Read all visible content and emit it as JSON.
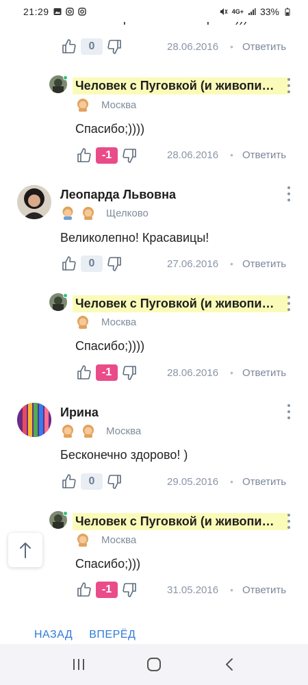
{
  "status_bar": {
    "time": "21:29",
    "network": "4G+",
    "battery": "33%"
  },
  "partial_comment": {
    "text": "Классно! Приятно посмотреть )))"
  },
  "comments": [
    {
      "score": "0",
      "date": "28.06.2016",
      "reply": "Ответить"
    },
    {
      "author": "Человек с Пуговкой (и живопи…",
      "city": "Москва",
      "text": "Спасибо;))))",
      "score": "-1",
      "date": "28.06.2016",
      "reply": "Ответить"
    },
    {
      "author": "Леопарда Львовна",
      "city": "Щелково",
      "text": "Великолепно! Красавицы!",
      "score": "0",
      "date": "27.06.2016",
      "reply": "Ответить"
    },
    {
      "author": "Человек с Пуговкой (и живопи…",
      "city": "Москва",
      "text": "Спасибо;))))",
      "score": "-1",
      "date": "28.06.2016",
      "reply": "Ответить"
    },
    {
      "author": "Ирина",
      "city": "Москва",
      "text": "Бесконечно здорово! )",
      "score": "0",
      "date": "29.05.2016",
      "reply": "Ответить"
    },
    {
      "author": "Человек с Пуговкой (и живопи…",
      "city": "Москва",
      "text": "Спасибо;)))",
      "score": "-1",
      "date": "31.05.2016",
      "reply": "Ответить"
    }
  ],
  "pager": {
    "back": "НАЗАД",
    "forward": "ВПЕРЁД"
  },
  "colors": {
    "accent_link": "#2f7ad6",
    "negative_score": "#ea4c89",
    "highlight": "#fbfbb9"
  }
}
